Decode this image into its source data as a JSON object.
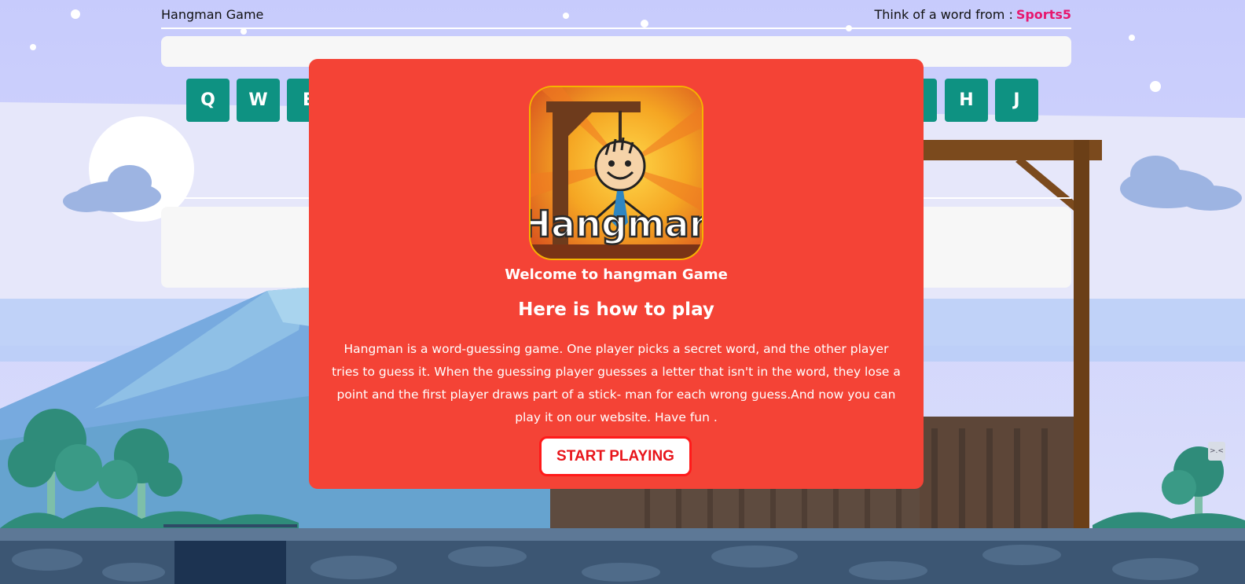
{
  "header": {
    "title": "Hangman Game",
    "hint_prefix": "Think of a word from :",
    "category": "Sports5"
  },
  "keyboard": {
    "keys": [
      "Q",
      "W",
      "E",
      "",
      "",
      "",
      "",
      "",
      "",
      "",
      "",
      "",
      "",
      "",
      "",
      "H",
      "J"
    ]
  },
  "modal": {
    "logo_text": "Hangman",
    "welcome": "Welcome to hangman Game",
    "heading": "Here is how to play",
    "description": "Hangman is a word-guessing game. One player picks a secret word, and the other player tries to guess it. When the guessing player guesses a letter that isn't in the word, they lose a point and the first player draws part of a stick- man for each wrong guess.And now you can play it on our website. Have fun .",
    "start_button": "START PLAYING"
  },
  "side_tab": {
    "label": ">.<"
  },
  "colors": {
    "modal_bg": "#f44336",
    "key_bg": "#0e9282",
    "category": "#e7176e",
    "start_border": "#ff1a1a"
  }
}
